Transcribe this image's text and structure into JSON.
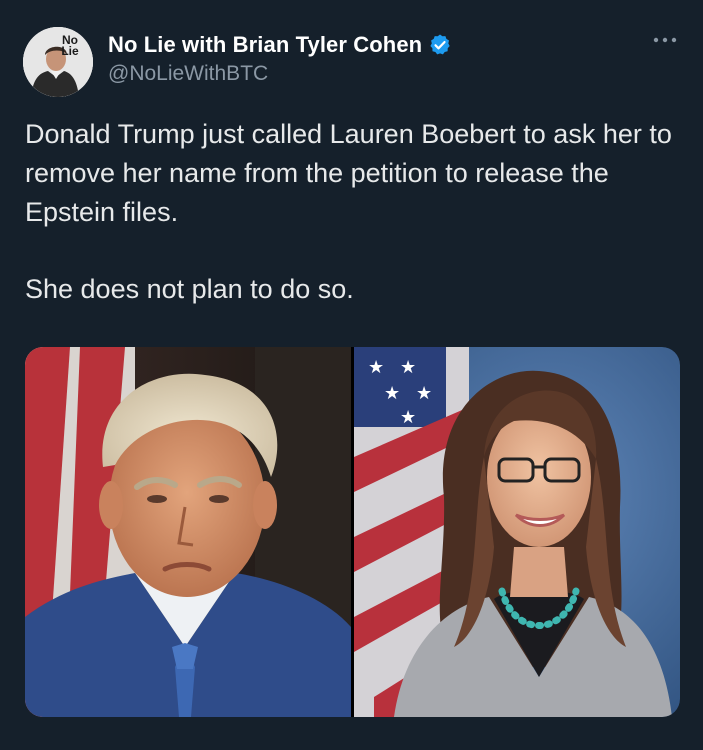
{
  "author": {
    "display_name": "No Lie with Brian Tyler Cohen",
    "handle": "@NoLieWithBTC",
    "avatar_logo_text": "No Lie",
    "verified_color": "#1d9bf0"
  },
  "tweet": {
    "paragraphs": [
      "Donald Trump just called Lauren Boebert to ask her to remove her name from the petition to release the Epstein files.",
      "She does not plan to do so."
    ]
  },
  "media": {
    "images": [
      {
        "name": "trump-portrait"
      },
      {
        "name": "boebert-portrait"
      }
    ]
  },
  "colors": {
    "background": "#15202b",
    "text": "#e7e9ea",
    "secondary_text": "#8b98a5"
  },
  "icons": [
    "verified-badge-icon",
    "more-options-icon"
  ]
}
